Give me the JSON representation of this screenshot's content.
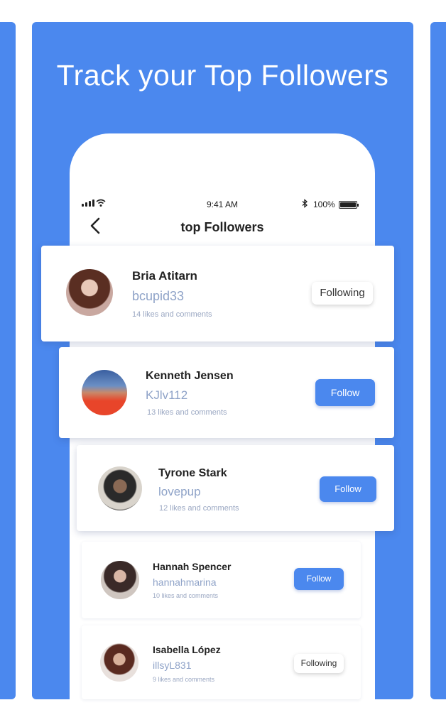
{
  "headline": "Track your Top Followers",
  "status_bar": {
    "time": "9:41 AM",
    "battery": "100%",
    "signal_icon": "signal-icon",
    "wifi_icon": "wifi-icon",
    "bluetooth_icon": "bluetooth-icon",
    "battery_icon": "battery-icon"
  },
  "nav": {
    "back_icon": "chevron-left-icon",
    "title": "top Followers"
  },
  "colors": {
    "brand_blue": "#4b88ee",
    "handle": "#8fa3c8",
    "meta": "#9aa7c2"
  },
  "followers": [
    {
      "name": "Bria Atitarn",
      "handle": "bcupid33",
      "activity": "14 likes and comments",
      "button": "Following"
    },
    {
      "name": "Kenneth  Jensen",
      "handle": "KJlv112",
      "activity": "13 likes and comments",
      "button": "Follow"
    },
    {
      "name": "Tyrone Stark",
      "handle": "lovepup",
      "activity": "12 likes and comments",
      "button": "Follow"
    },
    {
      "name": "Hannah  Spencer",
      "handle": "hannahmarina",
      "activity": "10 likes and comments",
      "button": "Follow"
    },
    {
      "name": "Isabella López",
      "handle": "illsyL831",
      "activity": "9 likes and comments",
      "button": "Following"
    }
  ]
}
